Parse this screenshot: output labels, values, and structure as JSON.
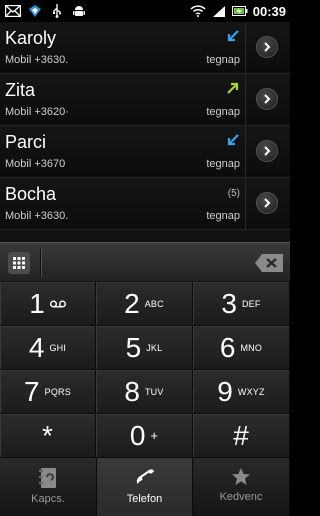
{
  "status_bar": {
    "time": "00:39",
    "left_icons": [
      "mail-icon",
      "dropbox-icon",
      "usb-icon",
      "android-icon"
    ],
    "right_icons": [
      "wifi-icon",
      "signal-icon",
      "battery-icon"
    ]
  },
  "call_log": [
    {
      "name": "Karoly",
      "number": "Mobil +3630.",
      "date": "tegnap",
      "type": "missed",
      "count": ""
    },
    {
      "name": "Zita",
      "number": "Mobil +3620·",
      "date": "tegnap",
      "type": "outgoing",
      "count": ""
    },
    {
      "name": "Parci",
      "number": "Mobil +3670",
      "date": "tegnap",
      "type": "missed",
      "count": ""
    },
    {
      "name": "Bocha",
      "number": "Mobil +3630.",
      "date": "tegnap",
      "type": "",
      "count": "(5)"
    }
  ],
  "entry": {
    "value": "",
    "placeholder": ""
  },
  "dialpad": [
    {
      "digit": "1",
      "letters": "",
      "voicemail": true
    },
    {
      "digit": "2",
      "letters": "ABC"
    },
    {
      "digit": "3",
      "letters": "DEF"
    },
    {
      "digit": "4",
      "letters": "GHI"
    },
    {
      "digit": "5",
      "letters": "JKL"
    },
    {
      "digit": "6",
      "letters": "MNO"
    },
    {
      "digit": "7",
      "letters": "PQRS"
    },
    {
      "digit": "8",
      "letters": "TUV"
    },
    {
      "digit": "9",
      "letters": "WXYZ"
    },
    {
      "digit": "*",
      "letters": ""
    },
    {
      "digit": "0",
      "letters": "+"
    },
    {
      "digit": "#",
      "letters": ""
    }
  ],
  "tabs": [
    {
      "label": "Kapcs.",
      "icon": "contacts-icon",
      "active": false
    },
    {
      "label": "Telefon",
      "icon": "phone-icon",
      "active": true
    },
    {
      "label": "Kedvenc",
      "icon": "star-icon",
      "active": false
    }
  ],
  "colors": {
    "missed_arrow": "#3aa3e8",
    "outgoing_arrow": "#a4d43a"
  }
}
